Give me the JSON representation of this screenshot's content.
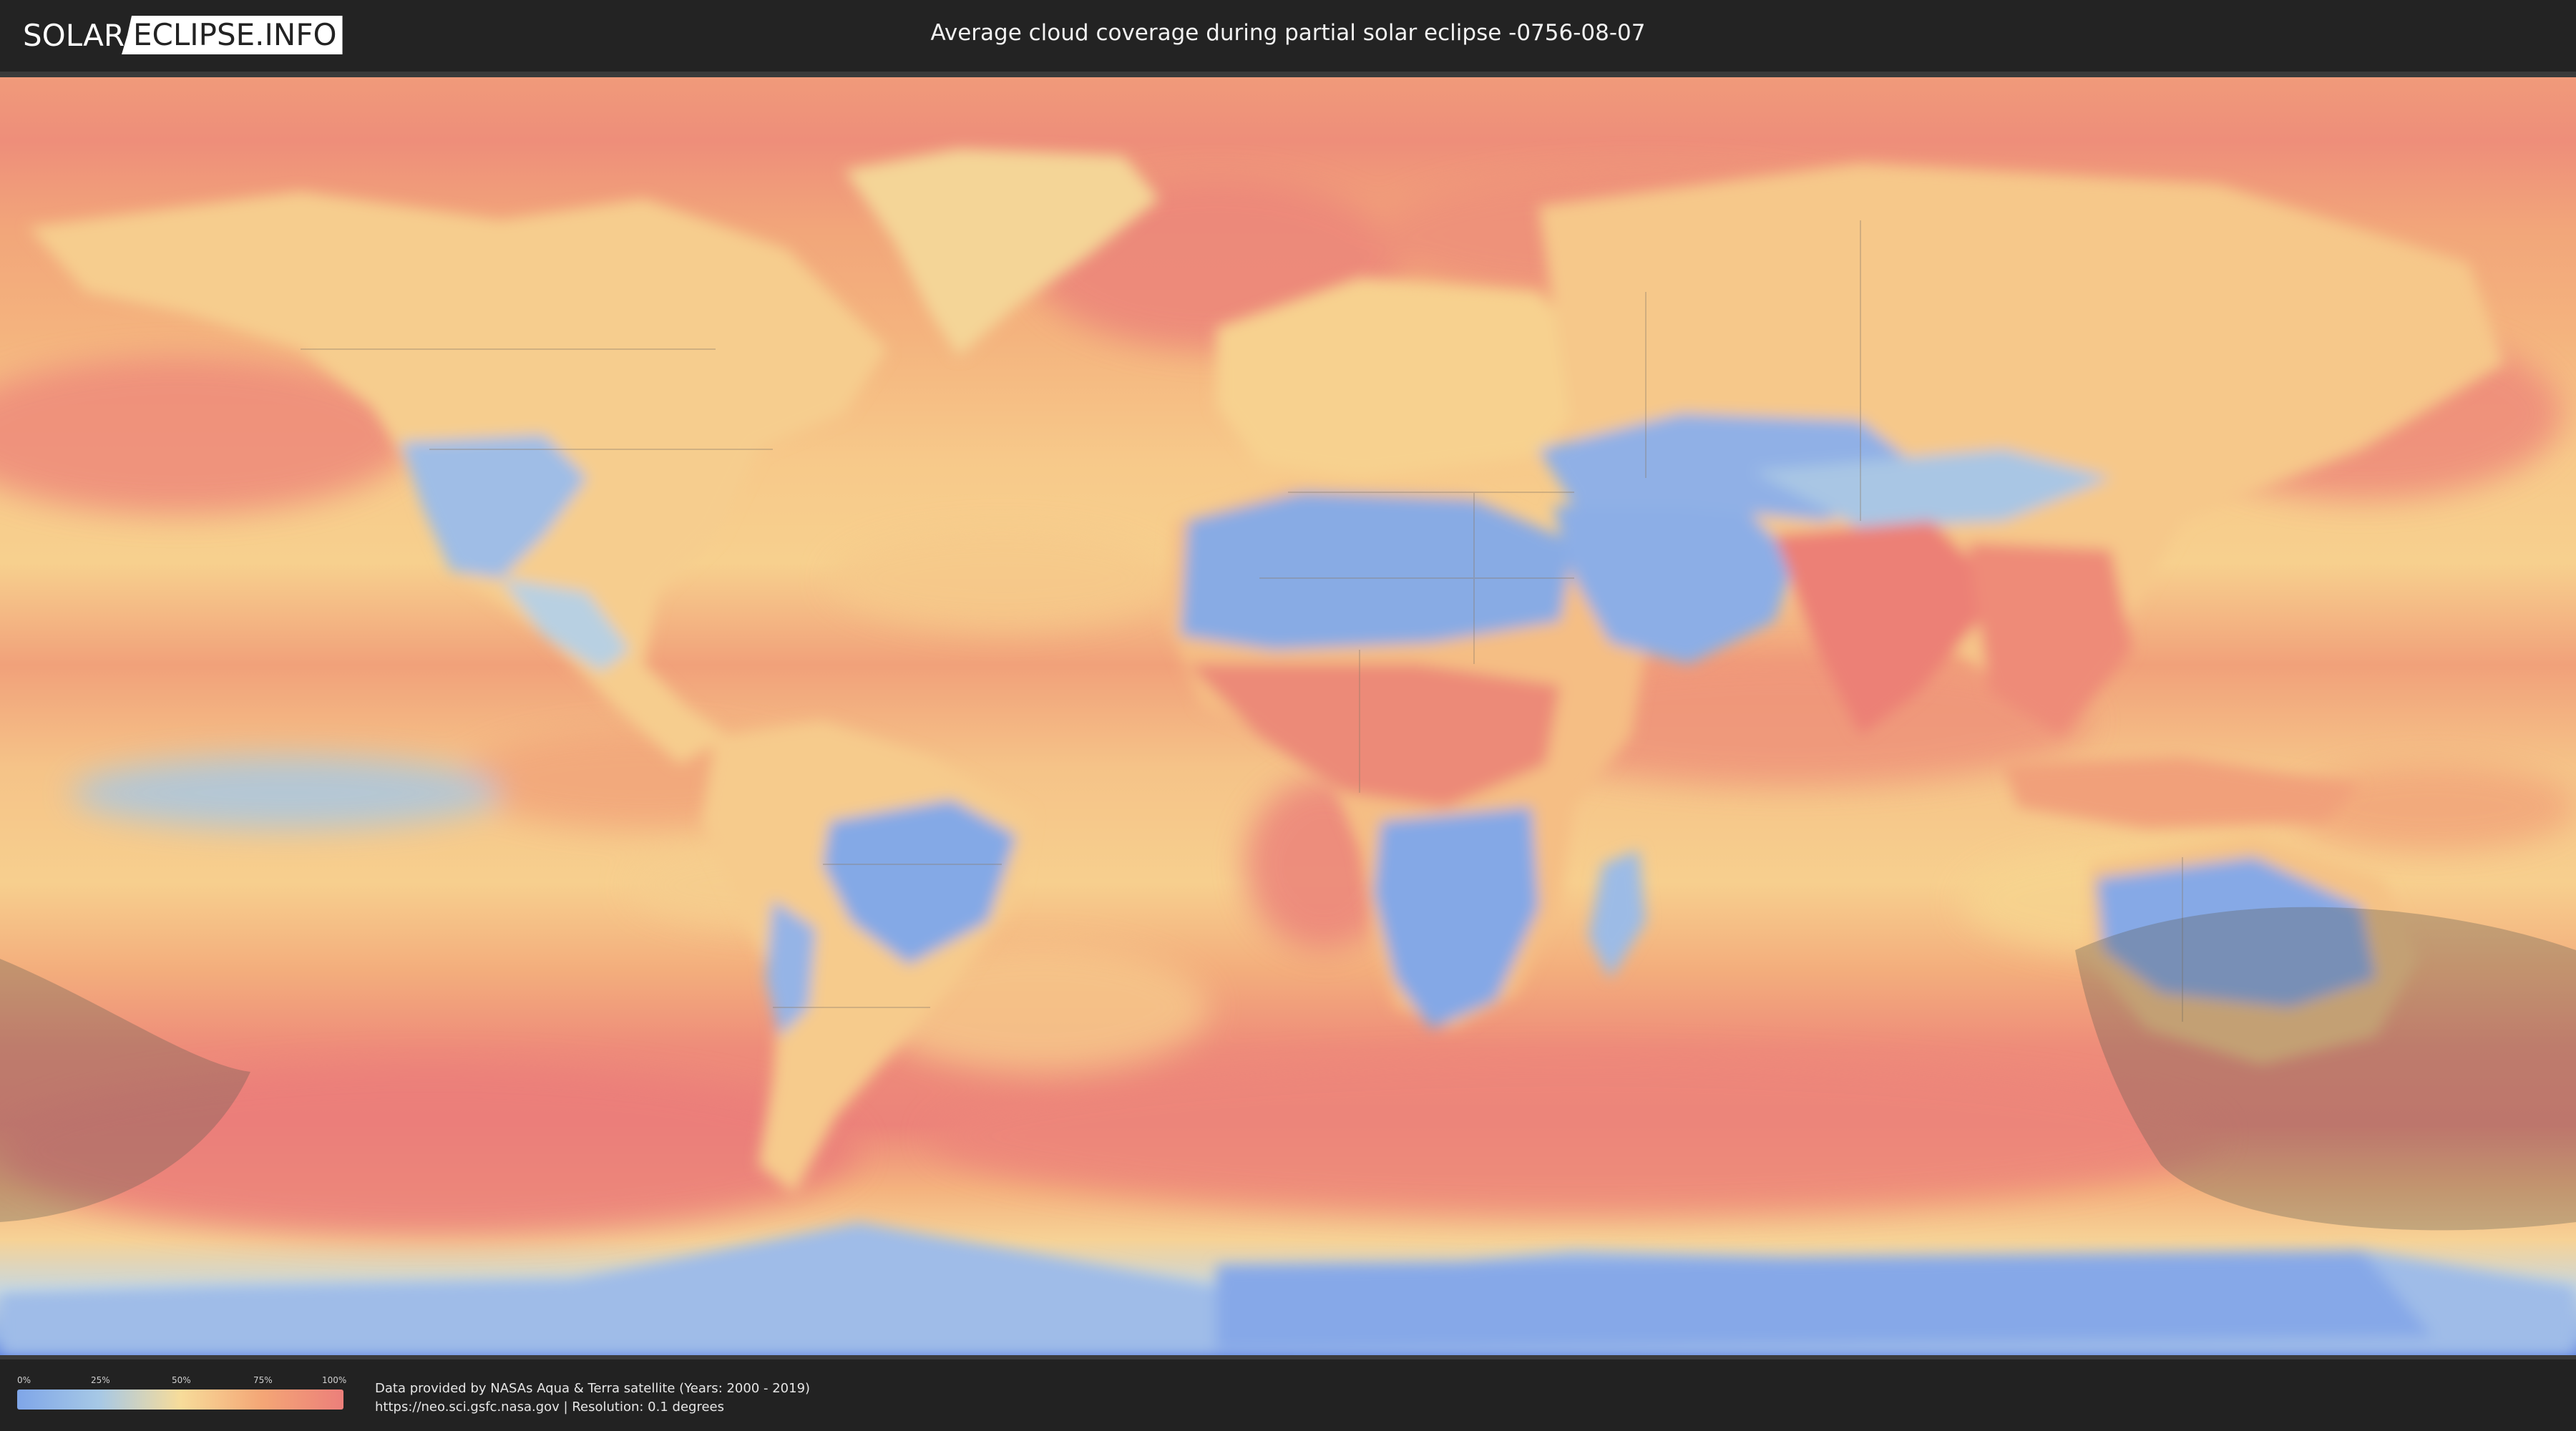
{
  "header": {
    "logo_left": "SOLAR",
    "logo_right": "ECLIPSE.INFO",
    "title": "Average cloud coverage during partial solar eclipse -0756-08-07"
  },
  "legend": {
    "ticks": [
      "0%",
      "25%",
      "50%",
      "75%",
      "100%"
    ],
    "colors": {
      "clear": "#7fa6e8",
      "low": "#a6c8e6",
      "mid": "#f7dc9a",
      "high": "#f4a676",
      "full": "#ec7f7a"
    }
  },
  "credits": {
    "line1": "Data provided by NASAs Aqua & Terra satellite (Years: 2000 - 2019)",
    "line2": "https://neo.sci.gsfc.nasa.gov | Resolution: 0.1 degrees"
  },
  "map": {
    "projection": "equirectangular",
    "layers": [
      "cloud-coverage-raster",
      "country-borders",
      "eclipse-visibility-shadow"
    ]
  }
}
